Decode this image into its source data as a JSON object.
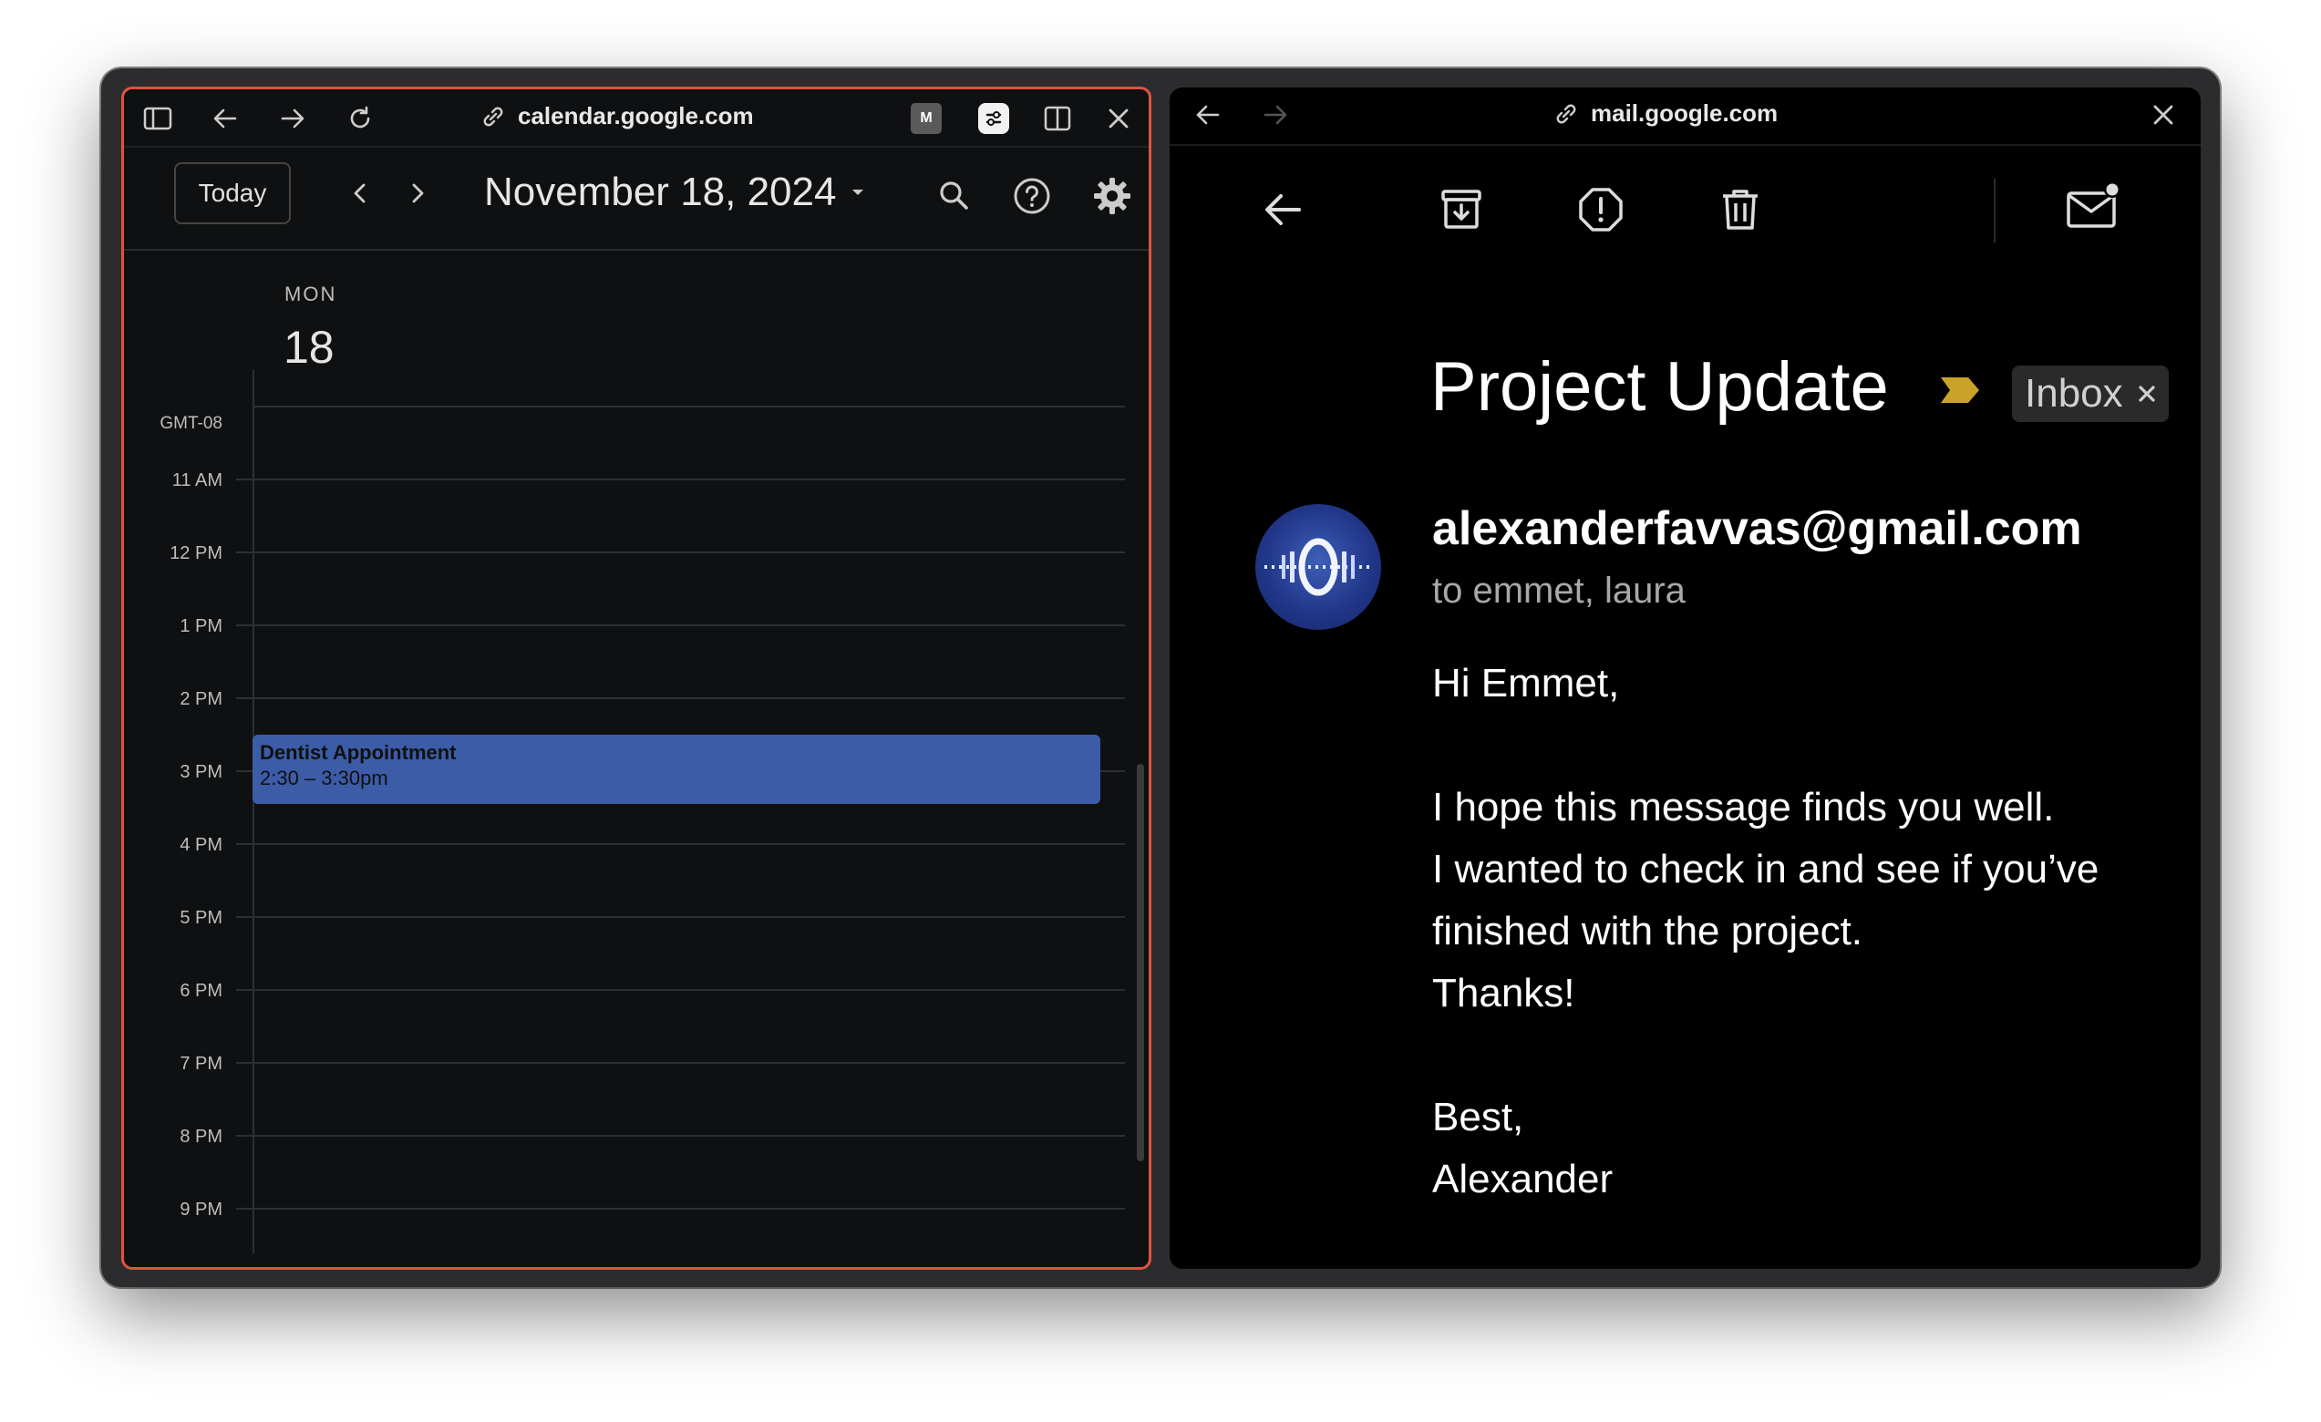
{
  "calendar": {
    "url": "calendar.google.com",
    "ext_badge": "M",
    "today_label": "Today",
    "date_title": "November 18, 2024",
    "day_name": "MON",
    "day_number": "18",
    "timezone": "GMT-08",
    "times": [
      "11 AM",
      "12 PM",
      "1 PM",
      "2 PM",
      "3 PM",
      "4 PM",
      "5 PM",
      "6 PM",
      "7 PM",
      "8 PM",
      "9 PM"
    ],
    "event": {
      "title": "Dentist Appointment",
      "time": "2:30 – 3:30pm",
      "color": "#3c5ca8"
    },
    "accent_border": "#e0523f"
  },
  "mail": {
    "url": "mail.google.com",
    "subject": "Project Update",
    "label_chip": "Inbox",
    "sender": "alexanderfavvas@gmail.com",
    "recipients": "to emmet, laura",
    "body": {
      "greeting": "Hi Emmet,",
      "line1": "I hope this message finds you well.",
      "line2": "I wanted to check in and see if you’ve",
      "line3": "finished with the project.",
      "line4": "Thanks!",
      "signoff": "Best,",
      "name": "Alexander"
    },
    "importance_color": "#c9a227"
  },
  "icons": [
    "sidebar-icon",
    "back-icon",
    "forward-icon",
    "reload-icon",
    "link-icon",
    "extension-icon",
    "settings-toggle-icon",
    "split-view-icon",
    "close-icon",
    "chevron-left-icon",
    "chevron-right-icon",
    "dropdown-caret-icon",
    "search-icon",
    "help-icon",
    "gear-icon",
    "archive-icon",
    "report-spam-icon",
    "delete-icon",
    "mark-unread-icon",
    "importance-marker-icon"
  ]
}
